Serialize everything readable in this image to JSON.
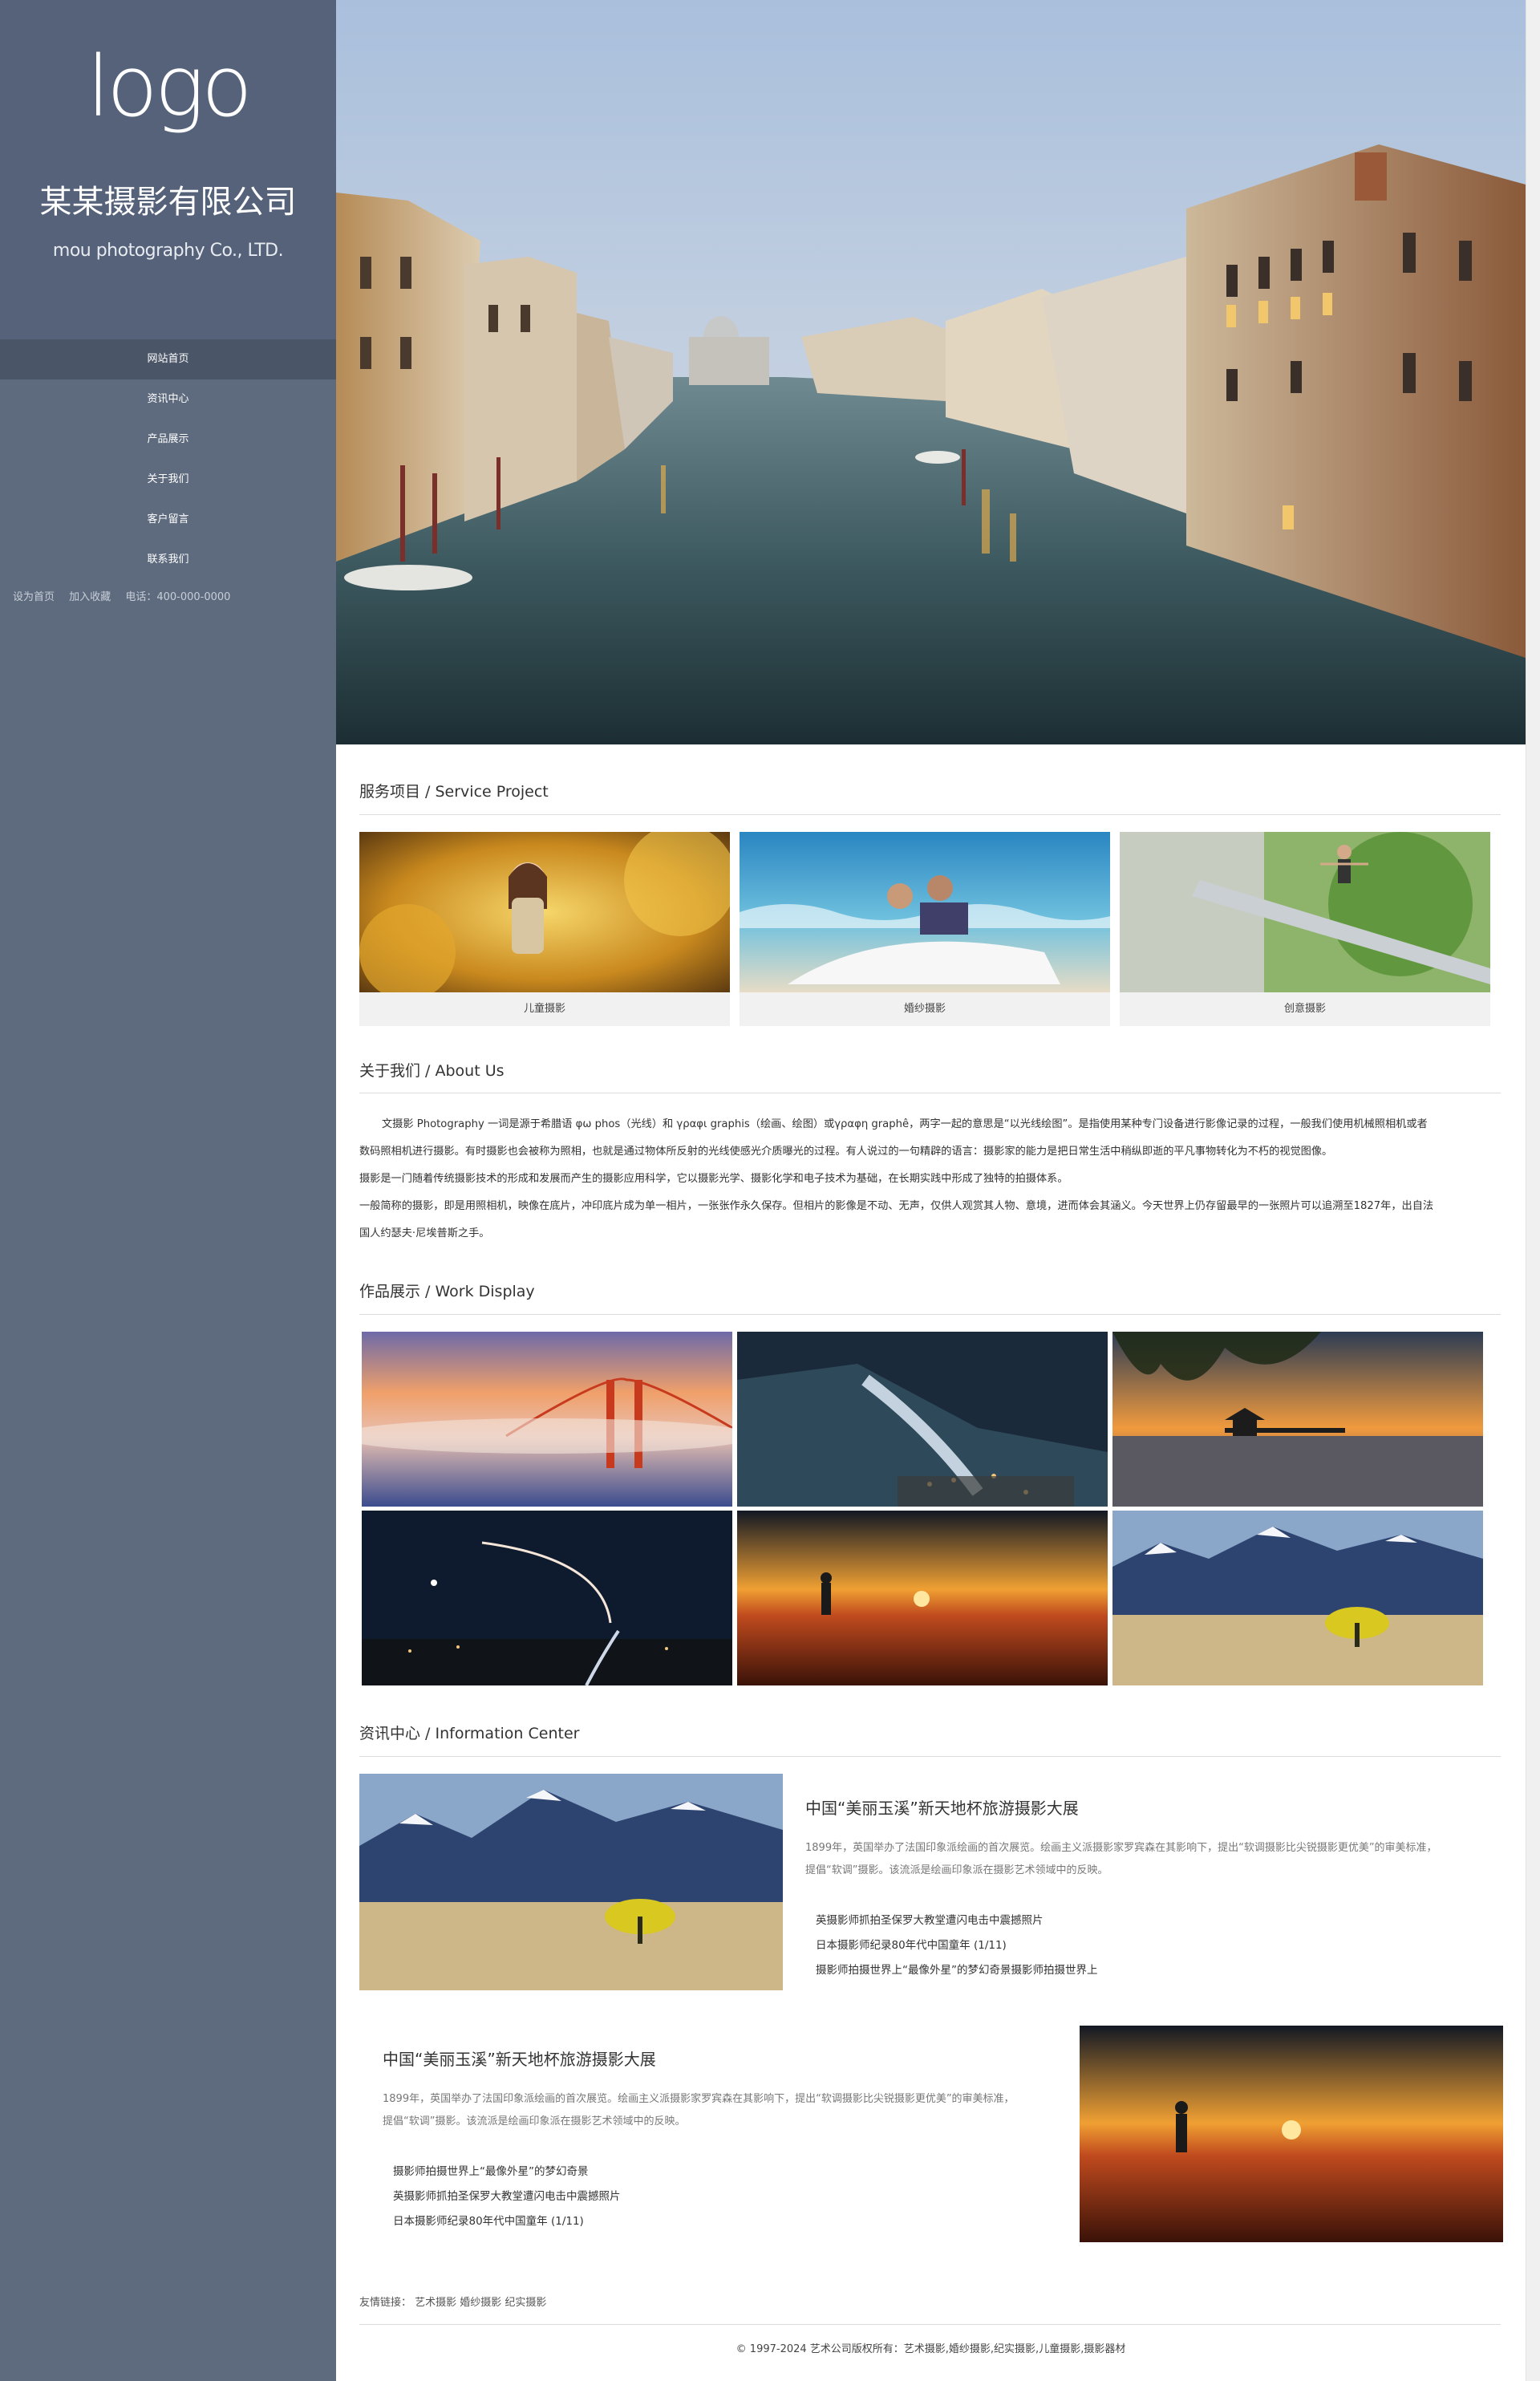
{
  "sidebar": {
    "logo": "logo",
    "company_cn": "某某摄影有限公司",
    "company_en": "mou photography  Co., LTD.",
    "nav": [
      "网站首页",
      "资讯中心",
      "产品展示",
      "关于我们",
      "客户留言",
      "联系我们"
    ],
    "links": {
      "home": "设为首页",
      "fav": "加入收藏",
      "phone": "电话：400-000-0000"
    }
  },
  "services": {
    "title": "服务项目 / Service Project",
    "items": [
      "儿童摄影",
      "婚纱摄影",
      "创意摄影"
    ]
  },
  "about": {
    "title": "关于我们 / About Us",
    "lines": [
      "文摄影 Photography 一词是源于希腊语 φω phos（光线）和 γραφι graphis（绘画、绘图）或γραφη graphê，两字一起的意思是“以光线绘图”。是指使用某种专门设备进行影像记录的过程，一般我们使用机械照相机或者",
      "数码照相机进行摄影。有时摄影也会被称为照相，也就是通过物体所反射的光线使感光介质曝光的过程。有人说过的一句精辟的语言：摄影家的能力是把日常生活中稍纵即逝的平凡事物转化为不朽的视觉图像。",
      "摄影是一门随着传统摄影技术的形成和发展而产生的摄影应用科学，它以摄影光学、摄影化学和电子技术为基础，在长期实践中形成了独特的拍摄体系。",
      "一般简称的摄影，即是用照相机，映像在底片，冲印底片成为单一相片，一张张作永久保存。但相片的影像是不动、无声，仅供人观赏其人物、意境，进而体会其涵义。今天世界上仍存留最早的一张照片可以追溯至1827年，出自法",
      "国人约瑟夫·尼埃普斯之手。"
    ]
  },
  "works": {
    "title": "作品展示 / Work Display"
  },
  "news": {
    "title": "资讯中心 / Information Center",
    "items": [
      {
        "headline": "中国“美丽玉溪”新天地杯旅游摄影大展",
        "desc1": "1899年，英国举办了法国印象派绘画的首次展览。绘画主义派摄影家罗宾森在其影响下，提出“软调摄影比尖锐摄影更优美”的审美标准，",
        "desc2": "提倡“软调”摄影。该流派是绘画印象派在摄影艺术领域中的反映。",
        "list": [
          "英摄影师抓拍圣保罗大教堂遭闪电击中震撼照片",
          "日本摄影师纪录80年代中国童年 (1/11)",
          "摄影师拍摄世界上“最像外星”的梦幻奇景摄影师拍摄世界上"
        ]
      },
      {
        "headline": "中国“美丽玉溪”新天地杯旅游摄影大展",
        "desc1": "1899年，英国举办了法国印象派绘画的首次展览。绘画主义派摄影家罗宾森在其影响下，提出“软调摄影比尖锐摄影更优美”的审美标准，",
        "desc2": "提倡“软调”摄影。该流派是绘画印象派在摄影艺术领域中的反映。",
        "list": [
          "摄影师拍摄世界上“最像外星”的梦幻奇景",
          "英摄影师抓拍圣保罗大教堂遭闪电击中震撼照片",
          "日本摄影师纪录80年代中国童年 (1/11)"
        ]
      }
    ]
  },
  "friend_links": "友情链接：  艺术摄影  婚纱摄影  纪实摄影",
  "footer": "© 1997-2024 艺术公司版权所有：艺术摄影,婚纱摄影,纪实摄影,儿童摄影,摄影器材",
  "colors": {
    "sidebar": "#5e6b7e",
    "logo_block": "#55627a",
    "nav_active": "#4a5567"
  }
}
